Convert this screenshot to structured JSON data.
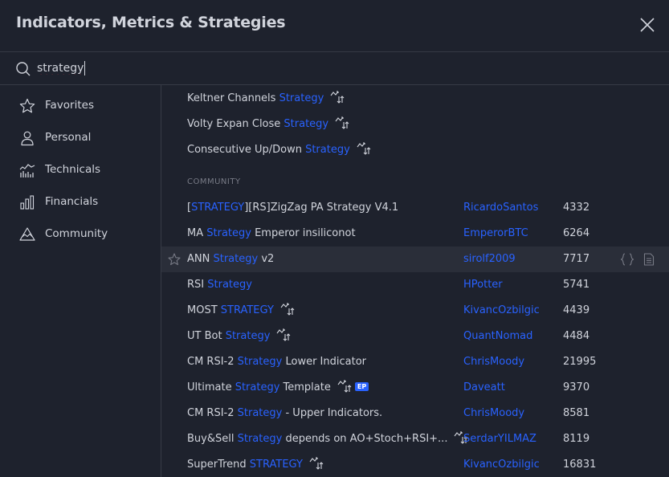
{
  "dialog": {
    "title": "Indicators, Metrics & Strategies"
  },
  "search": {
    "value": "strategy",
    "placeholder": "Search"
  },
  "sidebar": {
    "items": [
      {
        "label": "Favorites",
        "icon": "star-icon"
      },
      {
        "label": "Personal",
        "icon": "user-icon"
      },
      {
        "label": "Technicals",
        "icon": "technicals-chart-icon"
      },
      {
        "label": "Financials",
        "icon": "bar-chart-icon"
      },
      {
        "label": "Community",
        "icon": "community-icon"
      }
    ]
  },
  "builtin": [
    {
      "pre": "Keltner Channels ",
      "hl": "Strategy",
      "post": ""
    },
    {
      "pre": "Volty Expan Close ",
      "hl": "Strategy",
      "post": ""
    },
    {
      "pre": "Consecutive Up/Down ",
      "hl": "Strategy",
      "post": ""
    }
  ],
  "community_label": "COMMUNITY",
  "community": [
    {
      "pre": "[",
      "hl": "STRATEGY",
      "post": "][RS]ZigZag PA Strategy V4.1",
      "author": "RicardoSantos",
      "likes": "4332"
    },
    {
      "pre": "MA ",
      "hl": "Strategy",
      "post": " Emperor insiliconot",
      "author": "EmperorBTC",
      "likes": "6264"
    },
    {
      "pre": "ANN ",
      "hl": "Strategy",
      "post": " v2",
      "author": "sirolf2009",
      "likes": "7717"
    },
    {
      "pre": "RSI ",
      "hl": "Strategy",
      "post": "",
      "author": "HPotter",
      "likes": "5741"
    },
    {
      "pre": "MOST ",
      "hl": "STRATEGY",
      "post": "",
      "author": "KivancOzbilgic",
      "likes": "4439"
    },
    {
      "pre": "UT Bot ",
      "hl": "Strategy",
      "post": "",
      "author": "QuantNomad",
      "likes": "4484"
    },
    {
      "pre": "CM RSI-2 ",
      "hl": "Strategy",
      "post": " Lower Indicator",
      "author": "ChrisMoody",
      "likes": "21995"
    },
    {
      "pre": "Ultimate ",
      "hl": "Strategy",
      "post": " Template",
      "author": "Daveatt",
      "likes": "9370",
      "badge": "EP"
    },
    {
      "pre": "CM RSI-2 ",
      "hl": "Strategy",
      "post": " - Upper Indicators.",
      "author": "ChrisMoody",
      "likes": "8581"
    },
    {
      "pre": "Buy&Sell ",
      "hl": "Strategy",
      "post": " depends on AO+Stoch+RSI+...",
      "author": "SerdarYILMAZ",
      "likes": "8119"
    },
    {
      "pre": "SuperTrend ",
      "hl": "STRATEGY",
      "post": "",
      "author": "KivancOzbilgic",
      "likes": "16831"
    }
  ],
  "colors": {
    "accent": "#2962ff",
    "background": "#1e222d",
    "hover": "#2a2e39",
    "border": "#363a45",
    "text": "#d1d4dc",
    "muted": "#787b86"
  }
}
